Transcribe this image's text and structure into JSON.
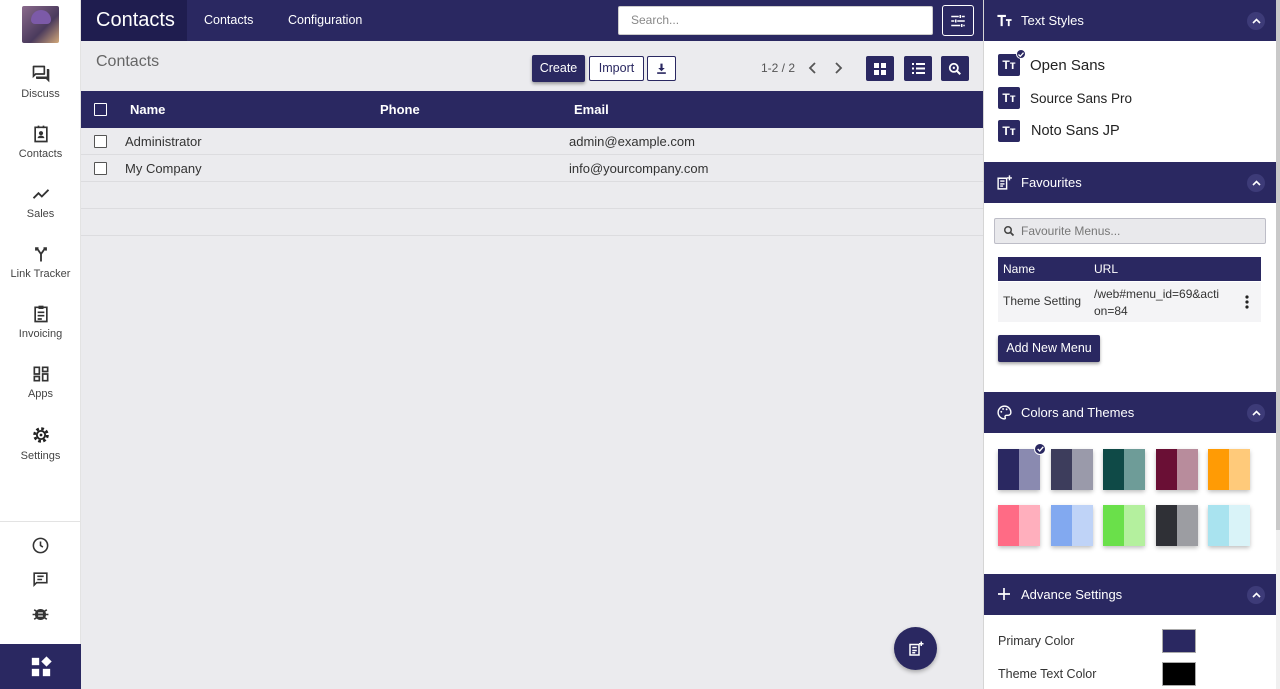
{
  "sidebar": {
    "items": [
      {
        "label": "Discuss",
        "icon": "chat-icon"
      },
      {
        "label": "Contacts",
        "icon": "contacts-icon"
      },
      {
        "label": "Sales",
        "icon": "trend-icon"
      },
      {
        "label": "Link Tracker",
        "icon": "merge-icon"
      },
      {
        "label": "Invoicing",
        "icon": "clipboard-icon"
      },
      {
        "label": "Apps",
        "icon": "apps-icon"
      },
      {
        "label": "Settings",
        "icon": "gear-icon"
      }
    ],
    "utilities": [
      "clock-icon",
      "message-icon",
      "bug-icon"
    ],
    "bottom_icon": "app-grid-icon"
  },
  "topbar": {
    "brand": "Contacts",
    "menus": [
      "Contacts",
      "Configuration"
    ],
    "search_placeholder": "Search..."
  },
  "control_panel": {
    "title": "Contacts",
    "create_label": "Create",
    "import_label": "Import",
    "pager": "1-2 / 2"
  },
  "list": {
    "columns": [
      "Name",
      "Phone",
      "Email"
    ],
    "rows": [
      {
        "name": "Administrator",
        "phone": "",
        "email": "admin@example.com"
      },
      {
        "name": "My Company",
        "phone": "",
        "email": "info@yourcompany.com"
      }
    ]
  },
  "panel": {
    "text_styles": {
      "title": "Text Styles",
      "fonts": [
        "Open Sans",
        "Source Sans Pro",
        "Noto Sans JP"
      ],
      "selected": "Open Sans"
    },
    "favourites": {
      "title": "Favourites",
      "search_placeholder": "Favourite Menus...",
      "columns": [
        "Name",
        "URL"
      ],
      "rows": [
        {
          "name": "Theme Setting",
          "url_line1": "/web#menu_id=69&acti",
          "url_line2": "on=84"
        }
      ],
      "add_label": "Add New Menu"
    },
    "colors": {
      "title": "Colors and Themes",
      "swatches": [
        [
          "#2a2861",
          "#8a8ab0"
        ],
        [
          "#3d3d5c",
          "#9a9aaa"
        ],
        [
          "#0f4a47",
          "#6e9c98"
        ],
        [
          "#6a0f35",
          "#b88c9c"
        ],
        [
          "#ff9b05",
          "#ffca7a"
        ],
        [
          "#ff6b85",
          "#ffafbd"
        ],
        [
          "#82a9f0",
          "#bfd3f7"
        ],
        [
          "#6ae04a",
          "#b4f09e"
        ],
        [
          "#2f3036",
          "#9c9da2"
        ],
        [
          "#a9e3ef",
          "#d9f3f8"
        ]
      ]
    },
    "advanced": {
      "title": "Advance Settings",
      "settings": [
        {
          "label": "Primary Color",
          "color": "#2a2861"
        },
        {
          "label": "Theme Text Color",
          "color": "#000000"
        }
      ]
    }
  }
}
